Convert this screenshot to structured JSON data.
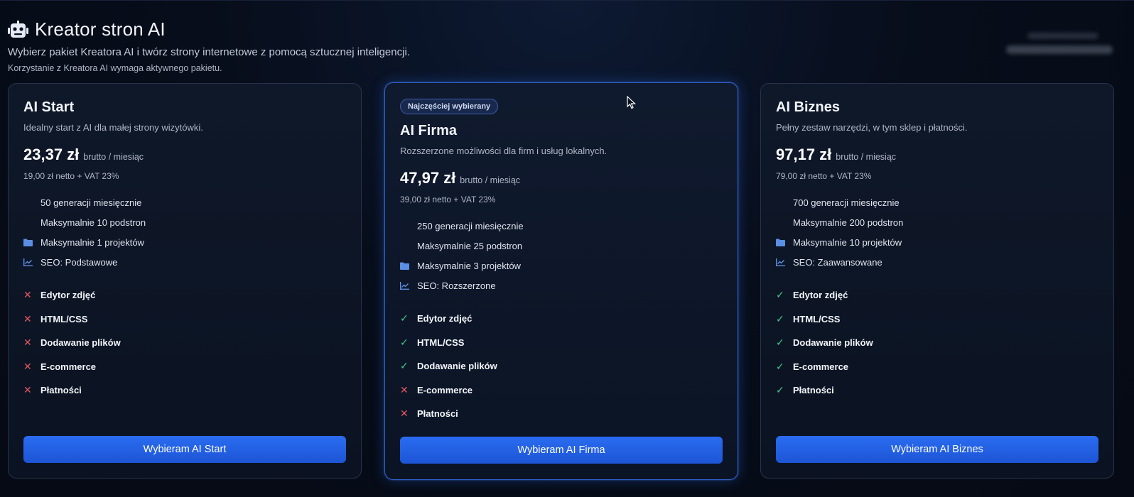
{
  "header": {
    "title": "Kreator stron AI",
    "subtitle": "Wybierz pakiet Kreatora AI i twórz strony internetowe z pomocą sztucznej inteligencji.",
    "note": "Korzystanie z Kreatora AI wymaga aktywnego pakietu."
  },
  "plans": [
    {
      "name": "AI Start",
      "description": "Idealny start z AI dla małej strony wizytówki.",
      "price": "23,37 zł",
      "price_unit": "brutto / miesiąc",
      "net": "19,00 zł netto + VAT 23%",
      "features": [
        "50 generacji miesięcznie",
        "Maksymalnie 10 podstron",
        "Maksymalnie 1 projektów",
        "SEO: Podstawowe"
      ],
      "toggles": [
        {
          "label": "Edytor zdjęć",
          "mark": "✕"
        },
        {
          "label": "HTML/CSS",
          "mark": "✕"
        },
        {
          "label": "Dodawanie plików",
          "mark": "✕"
        },
        {
          "label": "E-commerce",
          "mark": "✕"
        },
        {
          "label": "Płatności",
          "mark": "✕"
        }
      ],
      "button": "Wybieram AI Start"
    },
    {
      "badge": "Najczęściej wybierany",
      "name": "AI Firma",
      "description": "Rozszerzone możliwości dla firm i usług lokalnych.",
      "price": "47,97 zł",
      "price_unit": "brutto / miesiąc",
      "net": "39,00 zł netto + VAT 23%",
      "features": [
        "250 generacji miesięcznie",
        "Maksymalnie 25 podstron",
        "Maksymalnie 3 projektów",
        "SEO: Rozszerzone"
      ],
      "toggles": [
        {
          "label": "Edytor zdjęć",
          "mark": "✓"
        },
        {
          "label": "HTML/CSS",
          "mark": "✓"
        },
        {
          "label": "Dodawanie plików",
          "mark": "✓"
        },
        {
          "label": "E-commerce",
          "mark": "✕"
        },
        {
          "label": "Płatności",
          "mark": "✕"
        }
      ],
      "button": "Wybieram AI Firma"
    },
    {
      "name": "AI Biznes",
      "description": "Pełny zestaw narzędzi, w tym sklep i płatności.",
      "price": "97,17 zł",
      "price_unit": "brutto / miesiąc",
      "net": "79,00 zł netto + VAT 23%",
      "features": [
        "700 generacji miesięcznie",
        "Maksymalnie 200 podstron",
        "Maksymalnie 10 projektów",
        "SEO: Zaawansowane"
      ],
      "toggles": [
        {
          "label": "Edytor zdjęć",
          "mark": "✓"
        },
        {
          "label": "HTML/CSS",
          "mark": "✓"
        },
        {
          "label": "Dodawanie plików",
          "mark": "✓"
        },
        {
          "label": "E-commerce",
          "mark": "✓"
        },
        {
          "label": "Płatności",
          "mark": "✓"
        }
      ],
      "button": "Wybieram AI Biznes"
    }
  ],
  "colors": {
    "accent": "#2563eb",
    "check": "#44c98a",
    "cross": "#e4565f",
    "icon": "#5b8fe6"
  },
  "icons": {
    "header": "robot-icon",
    "feature_projects": "folder-icon",
    "feature_seo": "chart-line-icon"
  }
}
